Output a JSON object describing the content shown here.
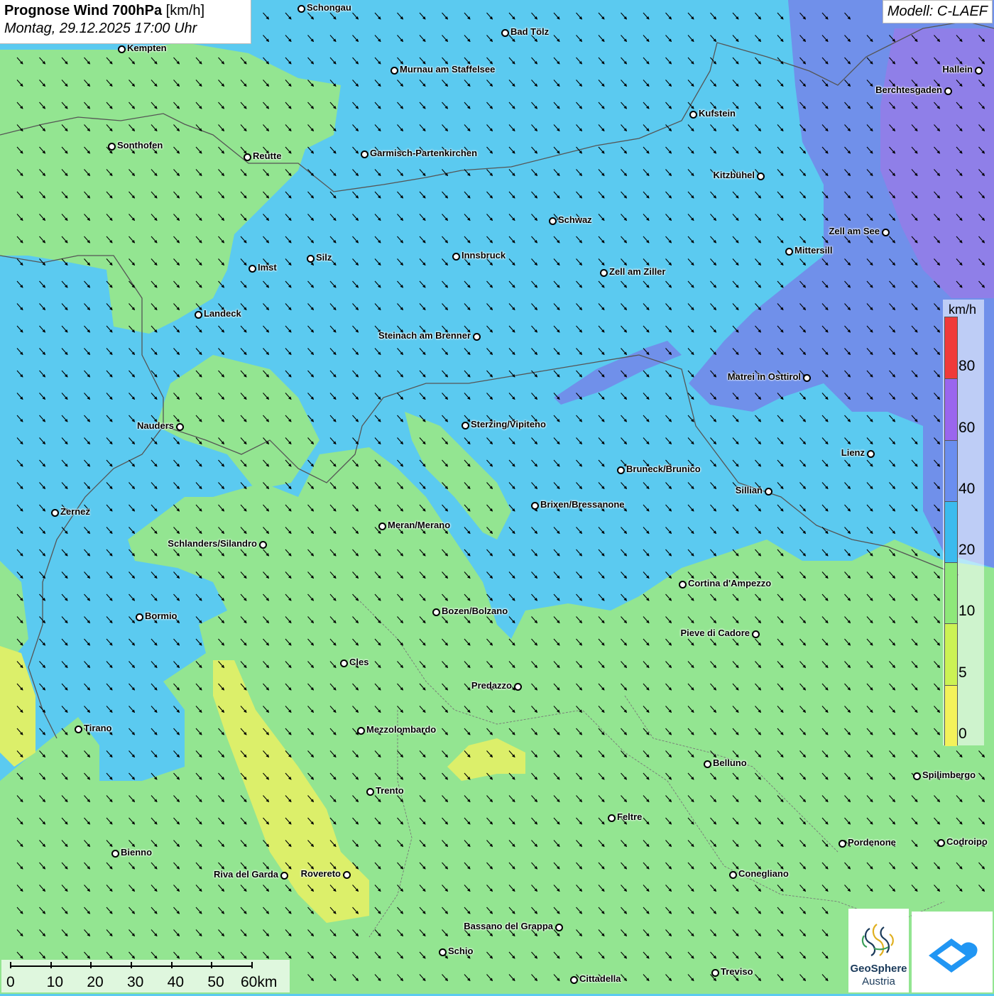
{
  "title": {
    "main": "Prognose Wind 700hPa",
    "unit": "[km/h]",
    "datetime": "Montag, 29.12.2025 17:00 Uhr"
  },
  "model": "Modell: C-LAEF",
  "legend": {
    "unit": "km/h",
    "labels": [
      "80",
      "60",
      "40",
      "20",
      "10",
      "5",
      "0"
    ],
    "colors": [
      "#f03a3a",
      "#9a66ee",
      "#6a8eef",
      "#3bbbee",
      "#8ee87a",
      "#ccf254",
      "#f4f25a"
    ]
  },
  "scale_bar": {
    "labels": [
      "0",
      "10",
      "20",
      "30",
      "40",
      "50",
      "60km"
    ]
  },
  "cities": [
    "Schongau",
    "Bad Tölz",
    "Kempten",
    "Murnau am Staffelsee",
    "Hallein",
    "Berchtesgaden",
    "Kufstein",
    "Sonthofen",
    "Reutte",
    "Garmisch-Partenkirchen",
    "Kitzbühel",
    "Schwaz",
    "Zell am See",
    "Mittersill",
    "Innsbruck",
    "Silz",
    "Imst",
    "Zell am Ziller",
    "Landeck",
    "Steinach am Brenner",
    "Matrei in Osttirol",
    "Nauders",
    "Sterzing/Vipiteno",
    "Lienz",
    "Bruneck/Brunico",
    "Sillian",
    "Brixen/Bressanone",
    "Zernez",
    "Meran/Merano",
    "Schlanders/Silandro",
    "Cortina d'Ampezzo",
    "Bozen/Bolzano",
    "Bormio",
    "Pieve di Cadore",
    "Cles",
    "Predazzo",
    "Tirano",
    "Mezzolombardo",
    "Belluno",
    "Spilimbergo",
    "Trento",
    "Feltre",
    "Pordenone",
    "Codroipo",
    "Bienno",
    "Riva del Garda",
    "Rovereto",
    "Conegliano",
    "Bassano del Grappa",
    "Schio",
    "Treviso",
    "Cittadella"
  ],
  "logos": {
    "geosphere_line1": "GeoSphere",
    "geosphere_line2": "Austria"
  },
  "colors": {
    "band_20_40": "#5bcaf0",
    "band_10_20": "#93e591",
    "band_5_10": "#dcef6a",
    "band_40_60": "#7090ea",
    "band_60_80": "#8f7fe8",
    "arrow": "#000000"
  }
}
